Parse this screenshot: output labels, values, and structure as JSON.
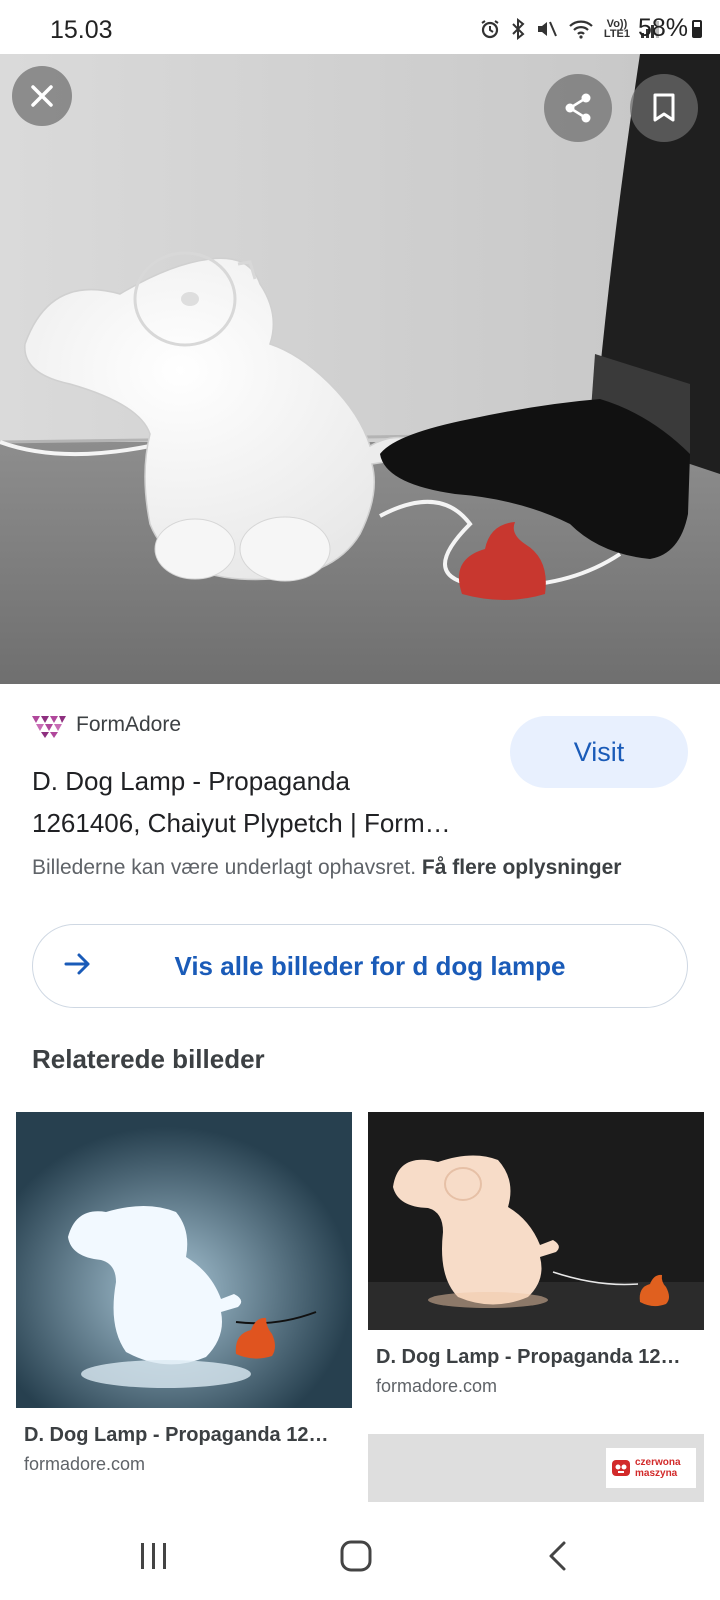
{
  "status_bar": {
    "time": "15.03",
    "volte_label_top": "Vo))",
    "volte_label_bottom": "LTE1",
    "battery": "58%"
  },
  "hero": {
    "close_icon": "close-icon",
    "share_icon": "share-icon",
    "bookmark_icon": "bookmark-icon"
  },
  "result": {
    "source_name": "FormAdore",
    "visit_label": "Visit",
    "title_line1": "D. Dog Lamp - Propaganda",
    "title_line2": "1261406, Chaiyut Plypetch | Form…",
    "copyright_text": "Billederne kan være underlagt ophavsret.",
    "more_info_link": "Få flere oplysninger",
    "all_images_label": "Vis alle billeder for d dog lampe"
  },
  "related": {
    "heading": "Relaterede billeder",
    "items": [
      {
        "title": "D. Dog Lamp - Propaganda 12…",
        "domain": "formadore.com"
      },
      {
        "title": "D. Dog Lamp - Propaganda 12…",
        "domain": "formadore.com"
      },
      {
        "logo_text_1": "czerwona",
        "logo_text_2": "maszyna"
      }
    ]
  },
  "nav": {
    "recents_icon": "recents-icon",
    "home_icon": "home-icon",
    "back_icon": "back-icon"
  },
  "colors": {
    "link_blue": "#1a5bb8",
    "visit_bg": "#e8f0fe",
    "poop_red": "#c8372f"
  }
}
